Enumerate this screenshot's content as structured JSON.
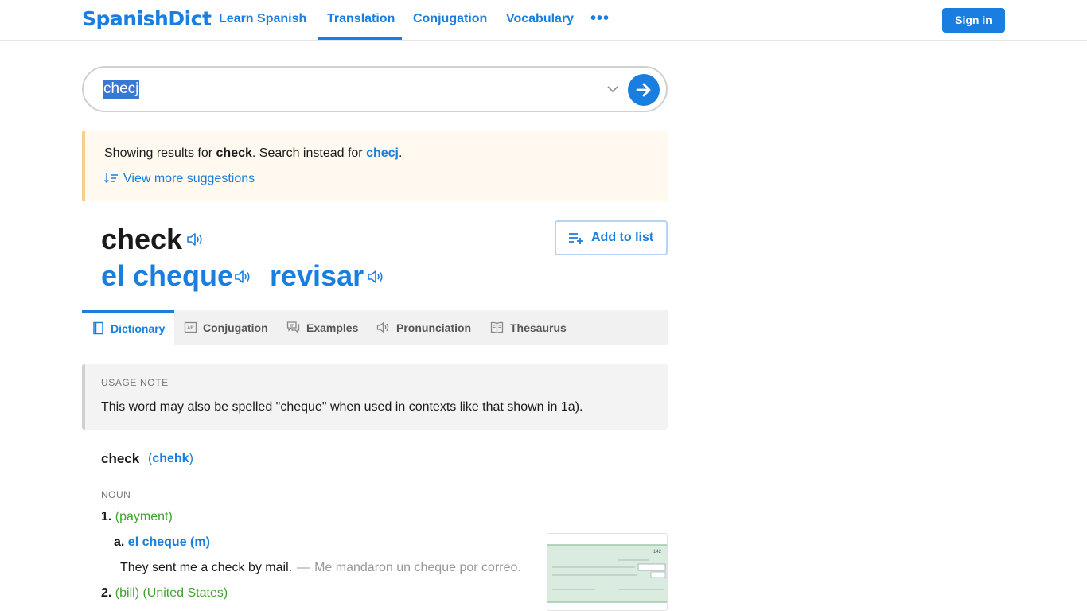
{
  "nav": {
    "logo": "SpanishDict",
    "links": [
      "Learn Spanish",
      "Translation",
      "Conjugation",
      "Vocabulary"
    ],
    "active_link": "Translation",
    "more": "•••",
    "sign_in": "Sign in",
    "accent": "#1a7ee0"
  },
  "search": {
    "value": "checj",
    "chevron_icon": "chevron-down-icon",
    "go_icon": "arrow-right-icon"
  },
  "suggestion": {
    "prefix": "Showing results for ",
    "result_word": "check",
    "middle": ". Search instead for ",
    "original_word": "checj",
    "suffix": ".",
    "more_label": "View more suggestions"
  },
  "headword": {
    "word": "check",
    "translations": [
      "el cheque",
      "revisar"
    ],
    "add_to_list": "Add to list"
  },
  "tabs": [
    {
      "label": "Dictionary",
      "icon": "book-icon",
      "active": true
    },
    {
      "label": "Conjugation",
      "icon": "conjugation-icon",
      "active": false
    },
    {
      "label": "Examples",
      "icon": "speech-bubbles-icon",
      "active": false
    },
    {
      "label": "Pronunciation",
      "icon": "speaker-icon",
      "active": false
    },
    {
      "label": "Thesaurus",
      "icon": "open-book-icon",
      "active": false
    }
  ],
  "usage_note": {
    "heading": "USAGE NOTE",
    "text": "This word may also be spelled \"cheque\" when used in contexts like that shown in 1a)."
  },
  "entry": {
    "word": "check",
    "pron_open": "(",
    "pronunciation": "chehk",
    "pron_close": ")",
    "part_of_speech": "NOUN",
    "senses": [
      {
        "num": "1.",
        "context": "(payment)"
      },
      {
        "num": "2.",
        "context": "(bill) (United States)"
      }
    ],
    "subsense": {
      "letter": "a.",
      "translation": "el cheque (m)"
    },
    "example": {
      "en": "They sent me a check by mail.",
      "dash": "—",
      "es": "Me mandaron un cheque por correo."
    },
    "image_number": "142"
  }
}
